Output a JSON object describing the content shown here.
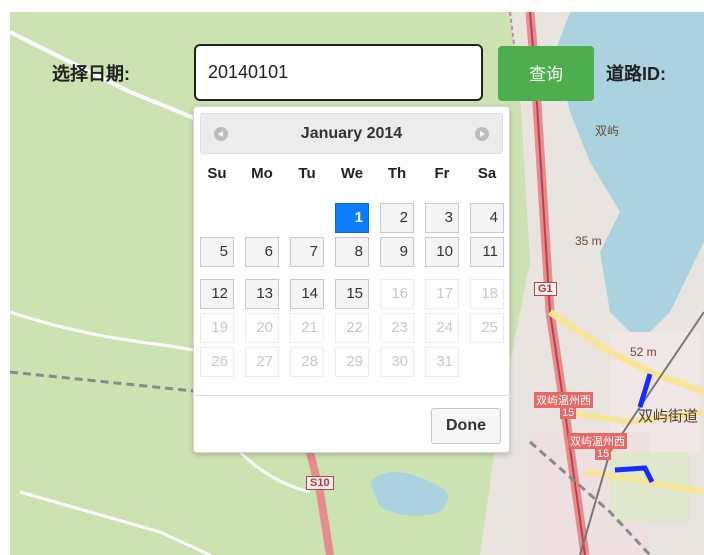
{
  "query": {
    "date_label": "选择日期:",
    "date_value": "20140101",
    "search_button": "查询",
    "road_id_label": "道路ID:"
  },
  "datepicker": {
    "month_title": "January 2014",
    "weekdays": [
      "Su",
      "Mo",
      "Tu",
      "We",
      "Th",
      "Fr",
      "Sa"
    ],
    "selected_day": "1",
    "done_label": "Done",
    "days": [
      {
        "label": "1",
        "state": "current"
      },
      {
        "label": "2",
        "state": "normal"
      },
      {
        "label": "3",
        "state": "normal"
      },
      {
        "label": "4",
        "state": "normal"
      },
      {
        "label": "5",
        "state": "normal"
      },
      {
        "label": "6",
        "state": "normal"
      },
      {
        "label": "7",
        "state": "normal"
      },
      {
        "label": "8",
        "state": "normal"
      },
      {
        "label": "9",
        "state": "normal"
      },
      {
        "label": "10",
        "state": "normal"
      },
      {
        "label": "11",
        "state": "normal"
      },
      {
        "label": "12",
        "state": "normal"
      },
      {
        "label": "13",
        "state": "normal"
      },
      {
        "label": "14",
        "state": "normal"
      },
      {
        "label": "15",
        "state": "normal"
      },
      {
        "label": "16",
        "state": "disabled"
      },
      {
        "label": "17",
        "state": "disabled"
      },
      {
        "label": "18",
        "state": "disabled"
      },
      {
        "label": "19",
        "state": "disabled"
      },
      {
        "label": "20",
        "state": "disabled"
      },
      {
        "label": "21",
        "state": "disabled"
      },
      {
        "label": "22",
        "state": "disabled"
      },
      {
        "label": "23",
        "state": "disabled"
      },
      {
        "label": "24",
        "state": "disabled"
      },
      {
        "label": "25",
        "state": "disabled"
      },
      {
        "label": "26",
        "state": "disabled"
      },
      {
        "label": "27",
        "state": "disabled"
      },
      {
        "label": "28",
        "state": "disabled"
      },
      {
        "label": "29",
        "state": "disabled"
      },
      {
        "label": "30",
        "state": "disabled"
      },
      {
        "label": "31",
        "state": "disabled"
      }
    ],
    "first_weekday_index": 3
  },
  "map": {
    "labels": {
      "shuangyu": "双屿",
      "height_35": "35 m",
      "height_52": "52 m",
      "g1": "G1",
      "s10": "S10",
      "shuangyu_street": "双屿街道",
      "wenzhou_west_1": "双屿温州西",
      "wenzhou_west_2": "双屿温州西",
      "num_15a": "15",
      "num_15b": "15"
    }
  },
  "colors": {
    "accent_green": "#4cae4c",
    "selected_day": "#0a7cff",
    "highlight_road": "#1a2bff"
  }
}
